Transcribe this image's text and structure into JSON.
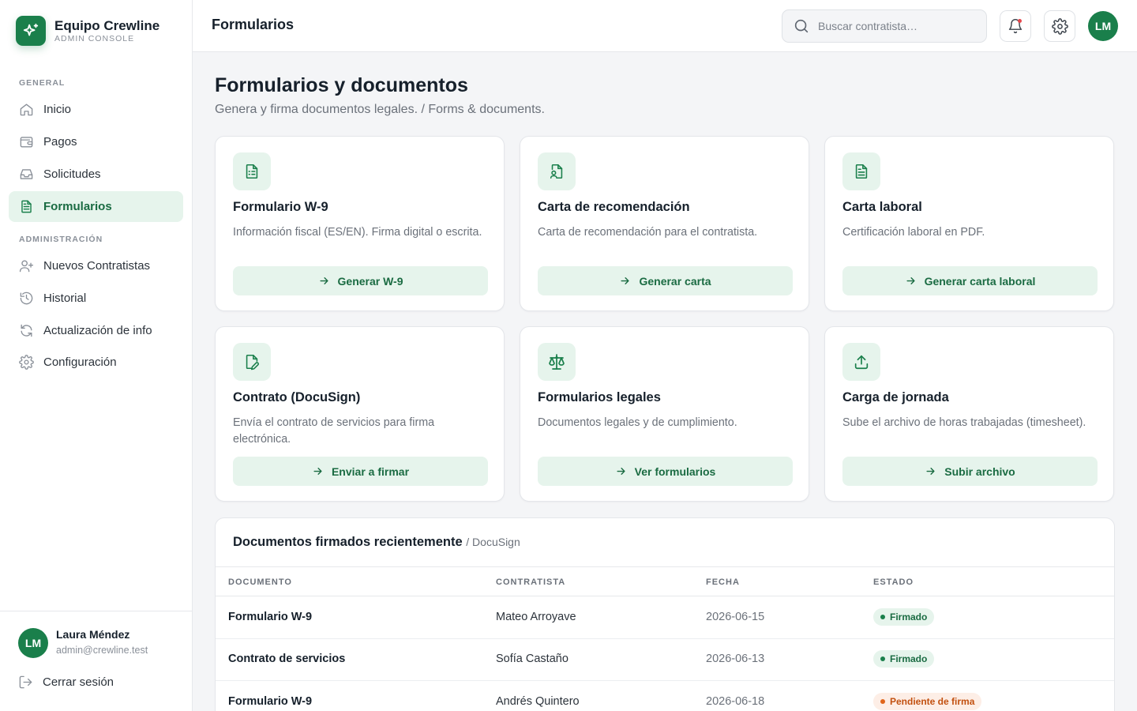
{
  "brand": {
    "name": "Equipo Crewline",
    "subtitle": "ADMIN CONSOLE"
  },
  "sidebar": {
    "section_general": "GENERAL",
    "section_admin": "ADMINISTRACIÓN",
    "items": [
      {
        "label": "Inicio",
        "icon": "home-icon"
      },
      {
        "label": "Pagos",
        "icon": "wallet-icon"
      },
      {
        "label": "Solicitudes",
        "icon": "inbox-icon"
      },
      {
        "label": "Formularios",
        "icon": "file-text-icon",
        "active": true
      },
      {
        "label": "Nuevos Contratistas",
        "icon": "user-plus-icon"
      },
      {
        "label": "Historial",
        "icon": "history-icon"
      },
      {
        "label": "Actualización de info",
        "icon": "refresh-icon"
      },
      {
        "label": "Configuración",
        "icon": "gear-icon"
      }
    ],
    "user": {
      "initials": "LM",
      "name": "Laura Méndez",
      "email": "admin@crewline.test"
    },
    "logout_label": "Cerrar sesión"
  },
  "topbar": {
    "title": "Formularios",
    "search_placeholder": "Buscar contratista…",
    "avatar_initials": "LM"
  },
  "main": {
    "title": "Formularios y documentos",
    "subtitle": "Genera y firma documentos legales. / Forms & documents.",
    "cards": [
      {
        "title": "Formulario W-9",
        "description": "Información fiscal (ES/EN). Firma digital o escrita.",
        "button": "Generar W-9",
        "icon": "file-form-icon"
      },
      {
        "title": "Carta de recomendación",
        "description": "Carta de recomendación para el contratista.",
        "button": "Generar carta",
        "icon": "file-user-icon"
      },
      {
        "title": "Carta laboral",
        "description": "Certificación laboral en PDF.",
        "button": "Generar carta laboral",
        "icon": "file-text-icon"
      },
      {
        "title": "Contrato (DocuSign)",
        "description": "Envía el contrato de servicios para firma electrónica.",
        "button": "Enviar a firmar",
        "icon": "file-signature-icon"
      },
      {
        "title": "Formularios legales",
        "description": "Documentos legales y de cumplimiento.",
        "button": "Ver formularios",
        "icon": "scale-icon"
      },
      {
        "title": "Carga de jornada",
        "description": "Sube el archivo de horas trabajadas (timesheet).",
        "button": "Subir archivo",
        "icon": "upload-icon"
      }
    ],
    "table": {
      "title": "Documentos firmados recientemente",
      "subtitle": "/ DocuSign",
      "columns": [
        "DOCUMENTO",
        "CONTRATISTA",
        "FECHA",
        "ESTADO"
      ],
      "rows": [
        {
          "document": "Formulario W-9",
          "contractor": "Mateo Arroyave",
          "date": "2026-06-15",
          "status": "Firmado",
          "status_type": "ok"
        },
        {
          "document": "Contrato de servicios",
          "contractor": "Sofía Castaño",
          "date": "2026-06-13",
          "status": "Firmado",
          "status_type": "ok"
        },
        {
          "document": "Formulario W-9",
          "contractor": "Andrés Quintero",
          "date": "2026-06-18",
          "status": "Pendiente de firma",
          "status_type": "pending"
        }
      ]
    }
  },
  "colors": {
    "accent": "#1a7f4b",
    "accent_soft": "#e6f4ec",
    "pending": "#c2500f",
    "pending_soft": "#fdeee6"
  }
}
